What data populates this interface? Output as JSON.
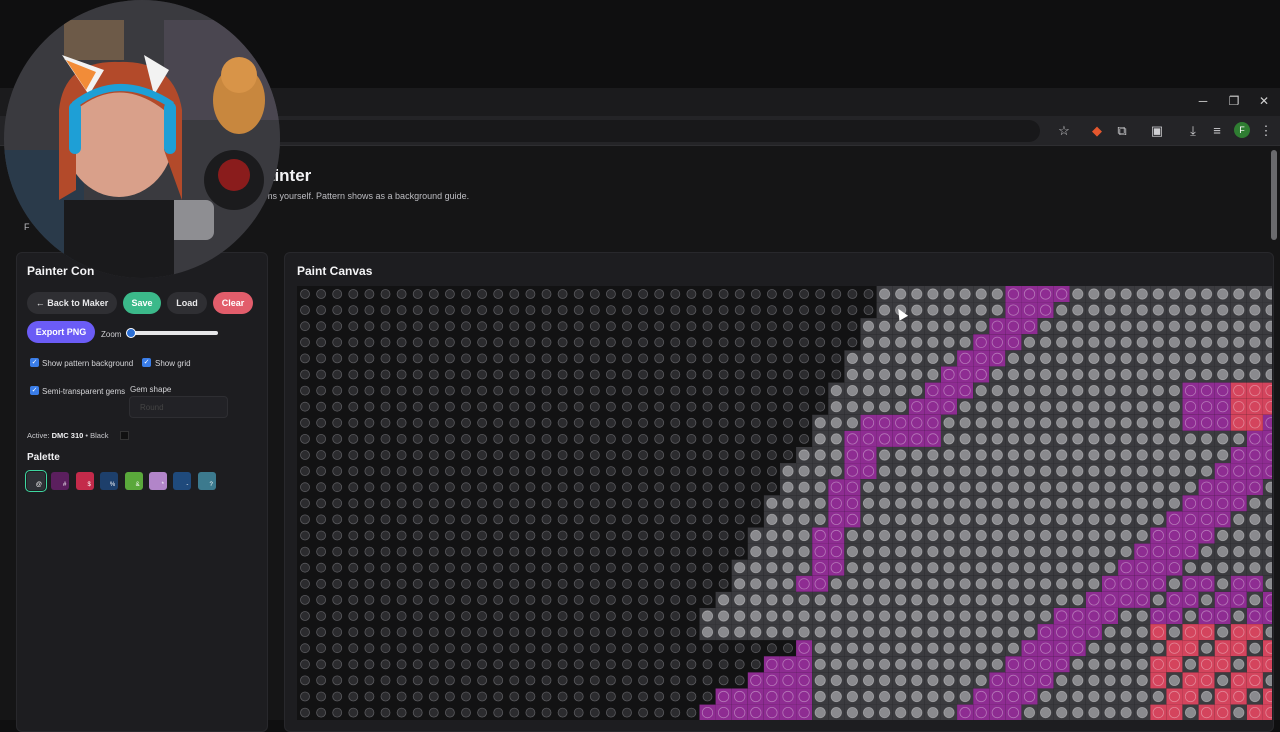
{
  "window": {
    "minimize": "─",
    "restore": "❐",
    "close": "✕"
  },
  "browser": {
    "profile_initial": "F"
  },
  "page": {
    "title": "ainter",
    "subtitle": "ms yourself. Pattern shows as a background guide.",
    "side_tag": "F"
  },
  "controls": {
    "title": "Painter Con",
    "back": "← Back to Maker",
    "save": "Save",
    "load": "Load",
    "clear": "Clear",
    "export": "Export PNG",
    "zoom_label": "Zoom",
    "zoom_value": 0,
    "show_pattern": "Show pattern background",
    "show_grid": "Show grid",
    "semi_transparent": "Semi-transparent gems",
    "gem_shape_label": "Gem shape",
    "gem_shape_value": "Round",
    "active_label": "Active:",
    "active_code": "DMC 310",
    "active_name": "• Black"
  },
  "palette": {
    "title": "Palette",
    "swatches": [
      {
        "symbol": "@",
        "color": "#2e3136",
        "selected": true
      },
      {
        "symbol": "#",
        "color": "#5b1f5e"
      },
      {
        "symbol": "$",
        "color": "#c42a4a"
      },
      {
        "symbol": "%",
        "color": "#1d3f6b"
      },
      {
        "symbol": "&",
        "color": "#5aa83b"
      },
      {
        "symbol": "*",
        "color": "#b285c9"
      },
      {
        "symbol": "-",
        "color": "#1f4a7c"
      },
      {
        "symbol": "?",
        "color": "#3c7a8e"
      }
    ]
  },
  "canvas": {
    "title": "Paint Canvas",
    "colors": {
      "black": "#1a1a1c",
      "gray": "#6e6e72",
      "purple": "#8e2c92",
      "pink": "#d4445d",
      "blue": "#2f6a96"
    }
  }
}
